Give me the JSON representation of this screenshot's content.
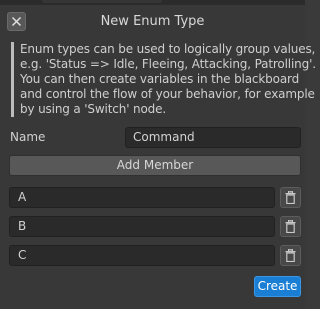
{
  "dialog": {
    "title": "New Enum Type",
    "close_icon": "close-icon"
  },
  "description": {
    "lines": [
      "Enum types can be used to logically group values,",
      "e.g. 'Status => Idle, Fleeing, Attacking, Patrolling'.",
      "You can then create variables in the blackboard",
      "and control the flow of your behavior, for example",
      "by using a 'Switch' node."
    ]
  },
  "name_field": {
    "label": "Name",
    "value": "Command"
  },
  "add_member_label": "Add Member",
  "members": [
    {
      "value": "A",
      "icon": "trash-icon"
    },
    {
      "value": "B",
      "icon": "trash-icon"
    },
    {
      "value": "C",
      "icon": "trash-icon"
    }
  ],
  "create_label": "Create",
  "colors": {
    "accent": "#1a7fd4",
    "background": "#383838",
    "field": "#2a2a2a"
  }
}
